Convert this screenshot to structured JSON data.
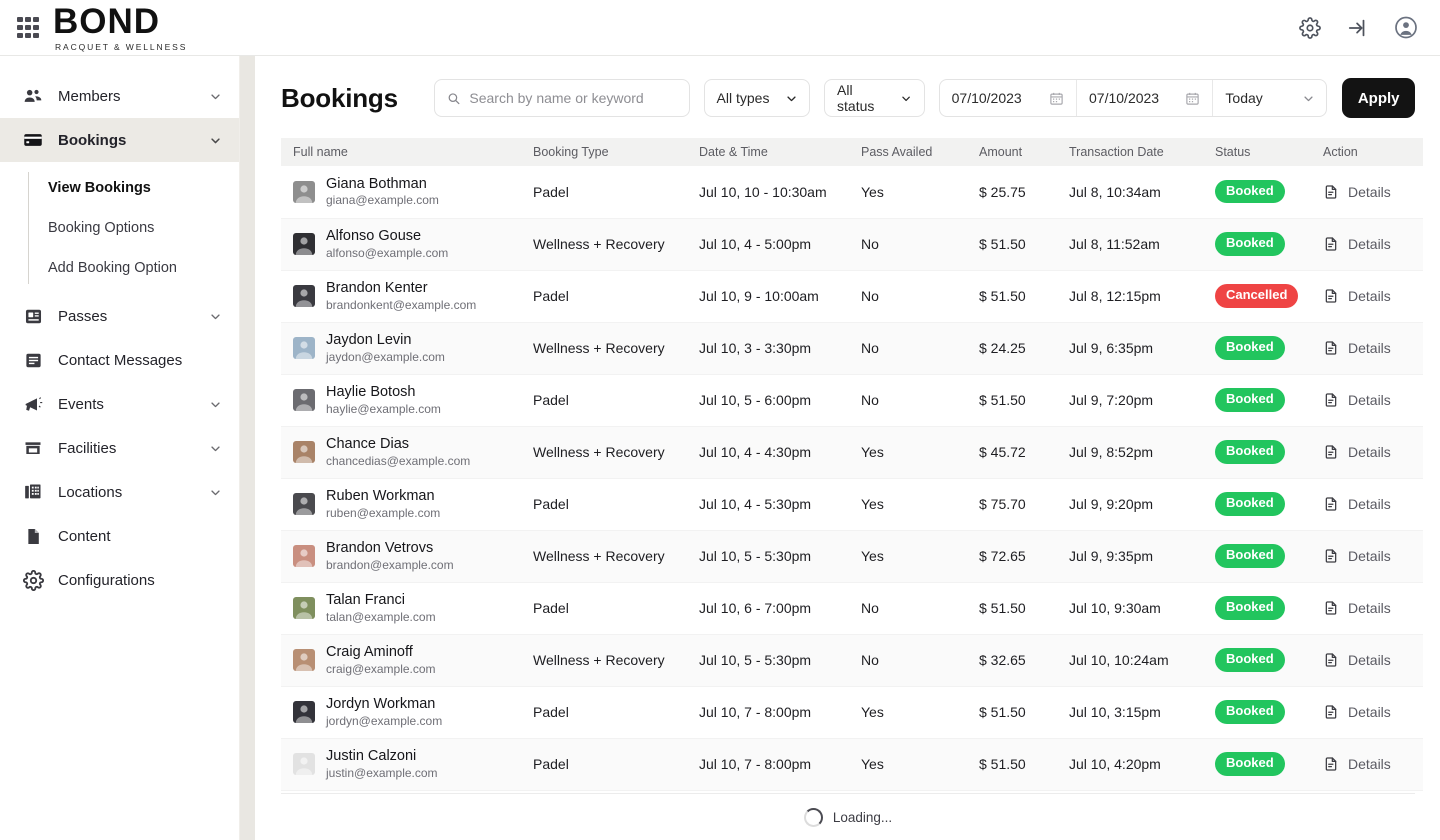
{
  "topbar": {
    "apps_icon": "grid-apps-icon",
    "brand_name": "BOND",
    "brand_tagline": "RACQUET & WELLNESS",
    "actions": [
      {
        "name": "settings-icon",
        "label": "Settings"
      },
      {
        "name": "login-icon",
        "label": "Sign in"
      },
      {
        "name": "account-avatar-icon",
        "label": "Account"
      }
    ]
  },
  "sidebar": {
    "items": [
      {
        "label": "Members",
        "icon": "members-icon",
        "expandable": true,
        "active": false
      },
      {
        "label": "Bookings",
        "icon": "card-icon",
        "expandable": true,
        "active": true
      },
      {
        "label": "Passes",
        "icon": "pass-icon",
        "expandable": true,
        "active": false
      },
      {
        "label": "Contact Messages",
        "icon": "message-icon",
        "expandable": false,
        "active": false
      },
      {
        "label": "Events",
        "icon": "megaphone-icon",
        "expandable": true,
        "active": false
      },
      {
        "label": "Facilities",
        "icon": "store-icon",
        "expandable": true,
        "active": false
      },
      {
        "label": "Locations",
        "icon": "building-icon",
        "expandable": true,
        "active": false
      },
      {
        "label": "Content",
        "icon": "document-icon",
        "expandable": false,
        "active": false
      },
      {
        "label": "Configurations",
        "icon": "gear-icon",
        "expandable": false,
        "active": false
      }
    ],
    "bookings_subitems": [
      {
        "label": "View Bookings",
        "active": true
      },
      {
        "label": "Booking Options",
        "active": false
      },
      {
        "label": "Add Booking Option",
        "active": false
      }
    ]
  },
  "toolbar": {
    "page_title": "Bookings",
    "search_placeholder": "Search by name or keyword",
    "search_value": "",
    "type_filter": "All types",
    "status_filter": "All status",
    "date_from": "07/10/2023",
    "date_to": "07/10/2023",
    "date_preset": "Today",
    "apply_label": "Apply"
  },
  "table": {
    "columns": [
      "Full name",
      "Booking Type",
      "Date & Time",
      "Pass Availed",
      "Amount",
      "Transaction Date",
      "Status",
      "Action"
    ],
    "details_label": "Details",
    "rows": [
      {
        "name": "Giana Bothman",
        "email": "giana@example.com",
        "type": "Padel",
        "datetime": "Jul 10, 10 - 10:30am",
        "pass": "Yes",
        "amount": "$ 25.75",
        "txn": "Jul 8, 10:34am",
        "status": "Booked",
        "avatar": "#8e8e8e"
      },
      {
        "name": "Alfonso Gouse",
        "email": "alfonso@example.com",
        "type": "Wellness + Recovery",
        "datetime": "Jul 10, 4 - 5:00pm",
        "pass": "No",
        "amount": "$ 51.50",
        "txn": "Jul 8, 11:52am",
        "status": "Booked",
        "avatar": "#2f2f33"
      },
      {
        "name": "Brandon Kenter",
        "email": "brandonkent@example.com",
        "type": "Padel",
        "datetime": "Jul 10, 9 - 10:00am",
        "pass": "No",
        "amount": "$ 51.50",
        "txn": "Jul 8, 12:15pm",
        "status": "Cancelled",
        "avatar": "#3a3a40"
      },
      {
        "name": "Jaydon Levin",
        "email": "jaydon@example.com",
        "type": "Wellness + Recovery",
        "datetime": "Jul 10, 3 - 3:30pm",
        "pass": "No",
        "amount": "$ 24.25",
        "txn": "Jul 9, 6:35pm",
        "status": "Booked",
        "avatar": "#9db4c8"
      },
      {
        "name": "Haylie Botosh",
        "email": "haylie@example.com",
        "type": "Padel",
        "datetime": "Jul 10, 5 - 6:00pm",
        "pass": "No",
        "amount": "$ 51.50",
        "txn": "Jul 9, 7:20pm",
        "status": "Booked",
        "avatar": "#6b6b70"
      },
      {
        "name": "Chance Dias",
        "email": "chancedias@example.com",
        "type": "Wellness + Recovery",
        "datetime": "Jul 10, 4 - 4:30pm",
        "pass": "Yes",
        "amount": "$ 45.72",
        "txn": "Jul 9, 8:52pm",
        "status": "Booked",
        "avatar": "#a98368"
      },
      {
        "name": "Ruben Workman",
        "email": "ruben@example.com",
        "type": "Padel",
        "datetime": "Jul 10, 4 - 5:30pm",
        "pass": "Yes",
        "amount": "$ 75.70",
        "txn": "Jul 9, 9:20pm",
        "status": "Booked",
        "avatar": "#4a4a4e"
      },
      {
        "name": "Brandon Vetrovs",
        "email": "brandon@example.com",
        "type": "Wellness + Recovery",
        "datetime": "Jul 10, 5 - 5:30pm",
        "pass": "Yes",
        "amount": "$ 72.65",
        "txn": "Jul 9, 9:35pm",
        "status": "Booked",
        "avatar": "#c98f80"
      },
      {
        "name": "Talan Franci",
        "email": "talan@example.com",
        "type": "Padel",
        "datetime": "Jul 10, 6 - 7:00pm",
        "pass": "No",
        "amount": "$ 51.50",
        "txn": "Jul 10, 9:30am",
        "status": "Booked",
        "avatar": "#7f8f5e"
      },
      {
        "name": "Craig Aminoff",
        "email": "craig@example.com",
        "type": "Wellness + Recovery",
        "datetime": "Jul 10, 5 - 5:30pm",
        "pass": "No",
        "amount": "$ 32.65",
        "txn": "Jul 10, 10:24am",
        "status": "Booked",
        "avatar": "#b88f74"
      },
      {
        "name": "Jordyn Workman",
        "email": "jordyn@example.com",
        "type": "Padel",
        "datetime": "Jul 10, 7 - 8:00pm",
        "pass": "Yes",
        "amount": "$ 51.50",
        "txn": "Jul 10, 3:15pm",
        "status": "Booked",
        "avatar": "#33333a"
      },
      {
        "name": "Justin Calzoni",
        "email": "justin@example.com",
        "type": "Padel",
        "datetime": "Jul 10, 7 - 8:00pm",
        "pass": "Yes",
        "amount": "$ 51.50",
        "txn": "Jul 10, 4:20pm",
        "status": "Booked",
        "avatar": "#e2e2e2"
      }
    ]
  },
  "footer": {
    "loading_text": "Loading..."
  },
  "colors": {
    "booked": "#22c55e",
    "cancelled": "#ef4444",
    "apply_button": "#131313",
    "sidebar_active": "#eceae5",
    "gutter": "#e9e7e2"
  }
}
